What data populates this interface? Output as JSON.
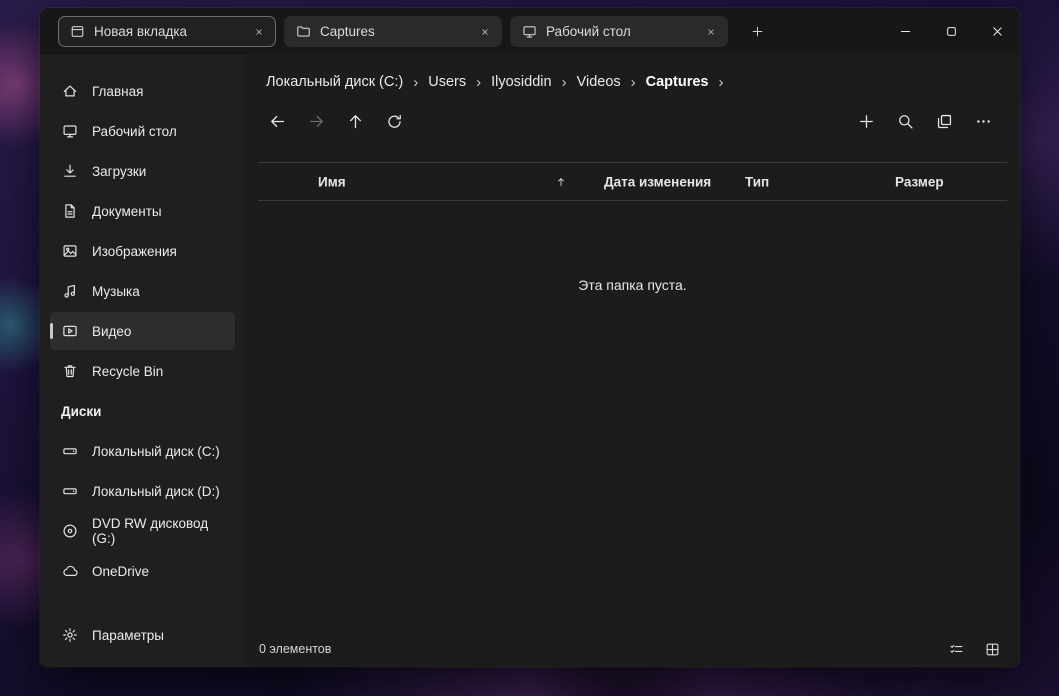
{
  "tabs": {
    "items": [
      {
        "label": "Новая вкладка",
        "icon": "tab-page-icon",
        "active": true
      },
      {
        "label": "Captures",
        "icon": "folder-icon",
        "active": false
      },
      {
        "label": "Рабочий стол",
        "icon": "monitor-icon",
        "active": false
      }
    ],
    "window_controls": [
      "minimize-icon",
      "maximize-icon",
      "close-icon"
    ]
  },
  "sidebar": {
    "items": [
      {
        "label": "Главная",
        "icon": "home-icon"
      },
      {
        "label": "Рабочий стол",
        "icon": "monitor-icon"
      },
      {
        "label": "Загрузки",
        "icon": "download-icon"
      },
      {
        "label": "Документы",
        "icon": "document-icon"
      },
      {
        "label": "Изображения",
        "icon": "image-icon"
      },
      {
        "label": "Музыка",
        "icon": "music-icon"
      },
      {
        "label": "Видео",
        "icon": "video-icon",
        "selected": true
      },
      {
        "label": "Recycle Bin",
        "icon": "trash-icon"
      }
    ],
    "drives_section_label": "Диски",
    "drives": [
      {
        "label": "Локальный диск (C:)",
        "icon": "drive-icon"
      },
      {
        "label": "Локальный диск (D:)",
        "icon": "drive-icon"
      },
      {
        "label": "DVD RW дисковод (G:)",
        "icon": "disc-icon"
      },
      {
        "label": "OneDrive",
        "icon": "cloud-icon"
      }
    ],
    "settings_label": "Параметры"
  },
  "breadcrumb": {
    "segments": [
      "Локальный диск (C:)",
      "Users",
      "Ilyosiddin",
      "Videos",
      "Captures"
    ],
    "separator": "›"
  },
  "toolbar": {
    "left_buttons": [
      "back-icon",
      "forward-icon",
      "up-icon",
      "refresh-icon"
    ],
    "right_buttons": [
      "new-item-icon",
      "search-icon",
      "copy-view-icon",
      "more-icon"
    ]
  },
  "file_list": {
    "columns": {
      "name": "Имя",
      "date_modified": "Дата изменения",
      "type": "Тип",
      "size": "Размер"
    },
    "sort": {
      "column": "name",
      "direction": "asc"
    },
    "empty_message": "Эта папка пуста."
  },
  "status_bar": {
    "items_count": "0 элементов",
    "view_buttons": [
      "details-view-icon",
      "thumbnails-view-icon"
    ]
  },
  "colors": {
    "window_bg": "#1f1f1f",
    "tab_strip_bg": "#171717",
    "selection_bg": "#2d2d2d",
    "selection_indicator": "#c8c8c8"
  }
}
